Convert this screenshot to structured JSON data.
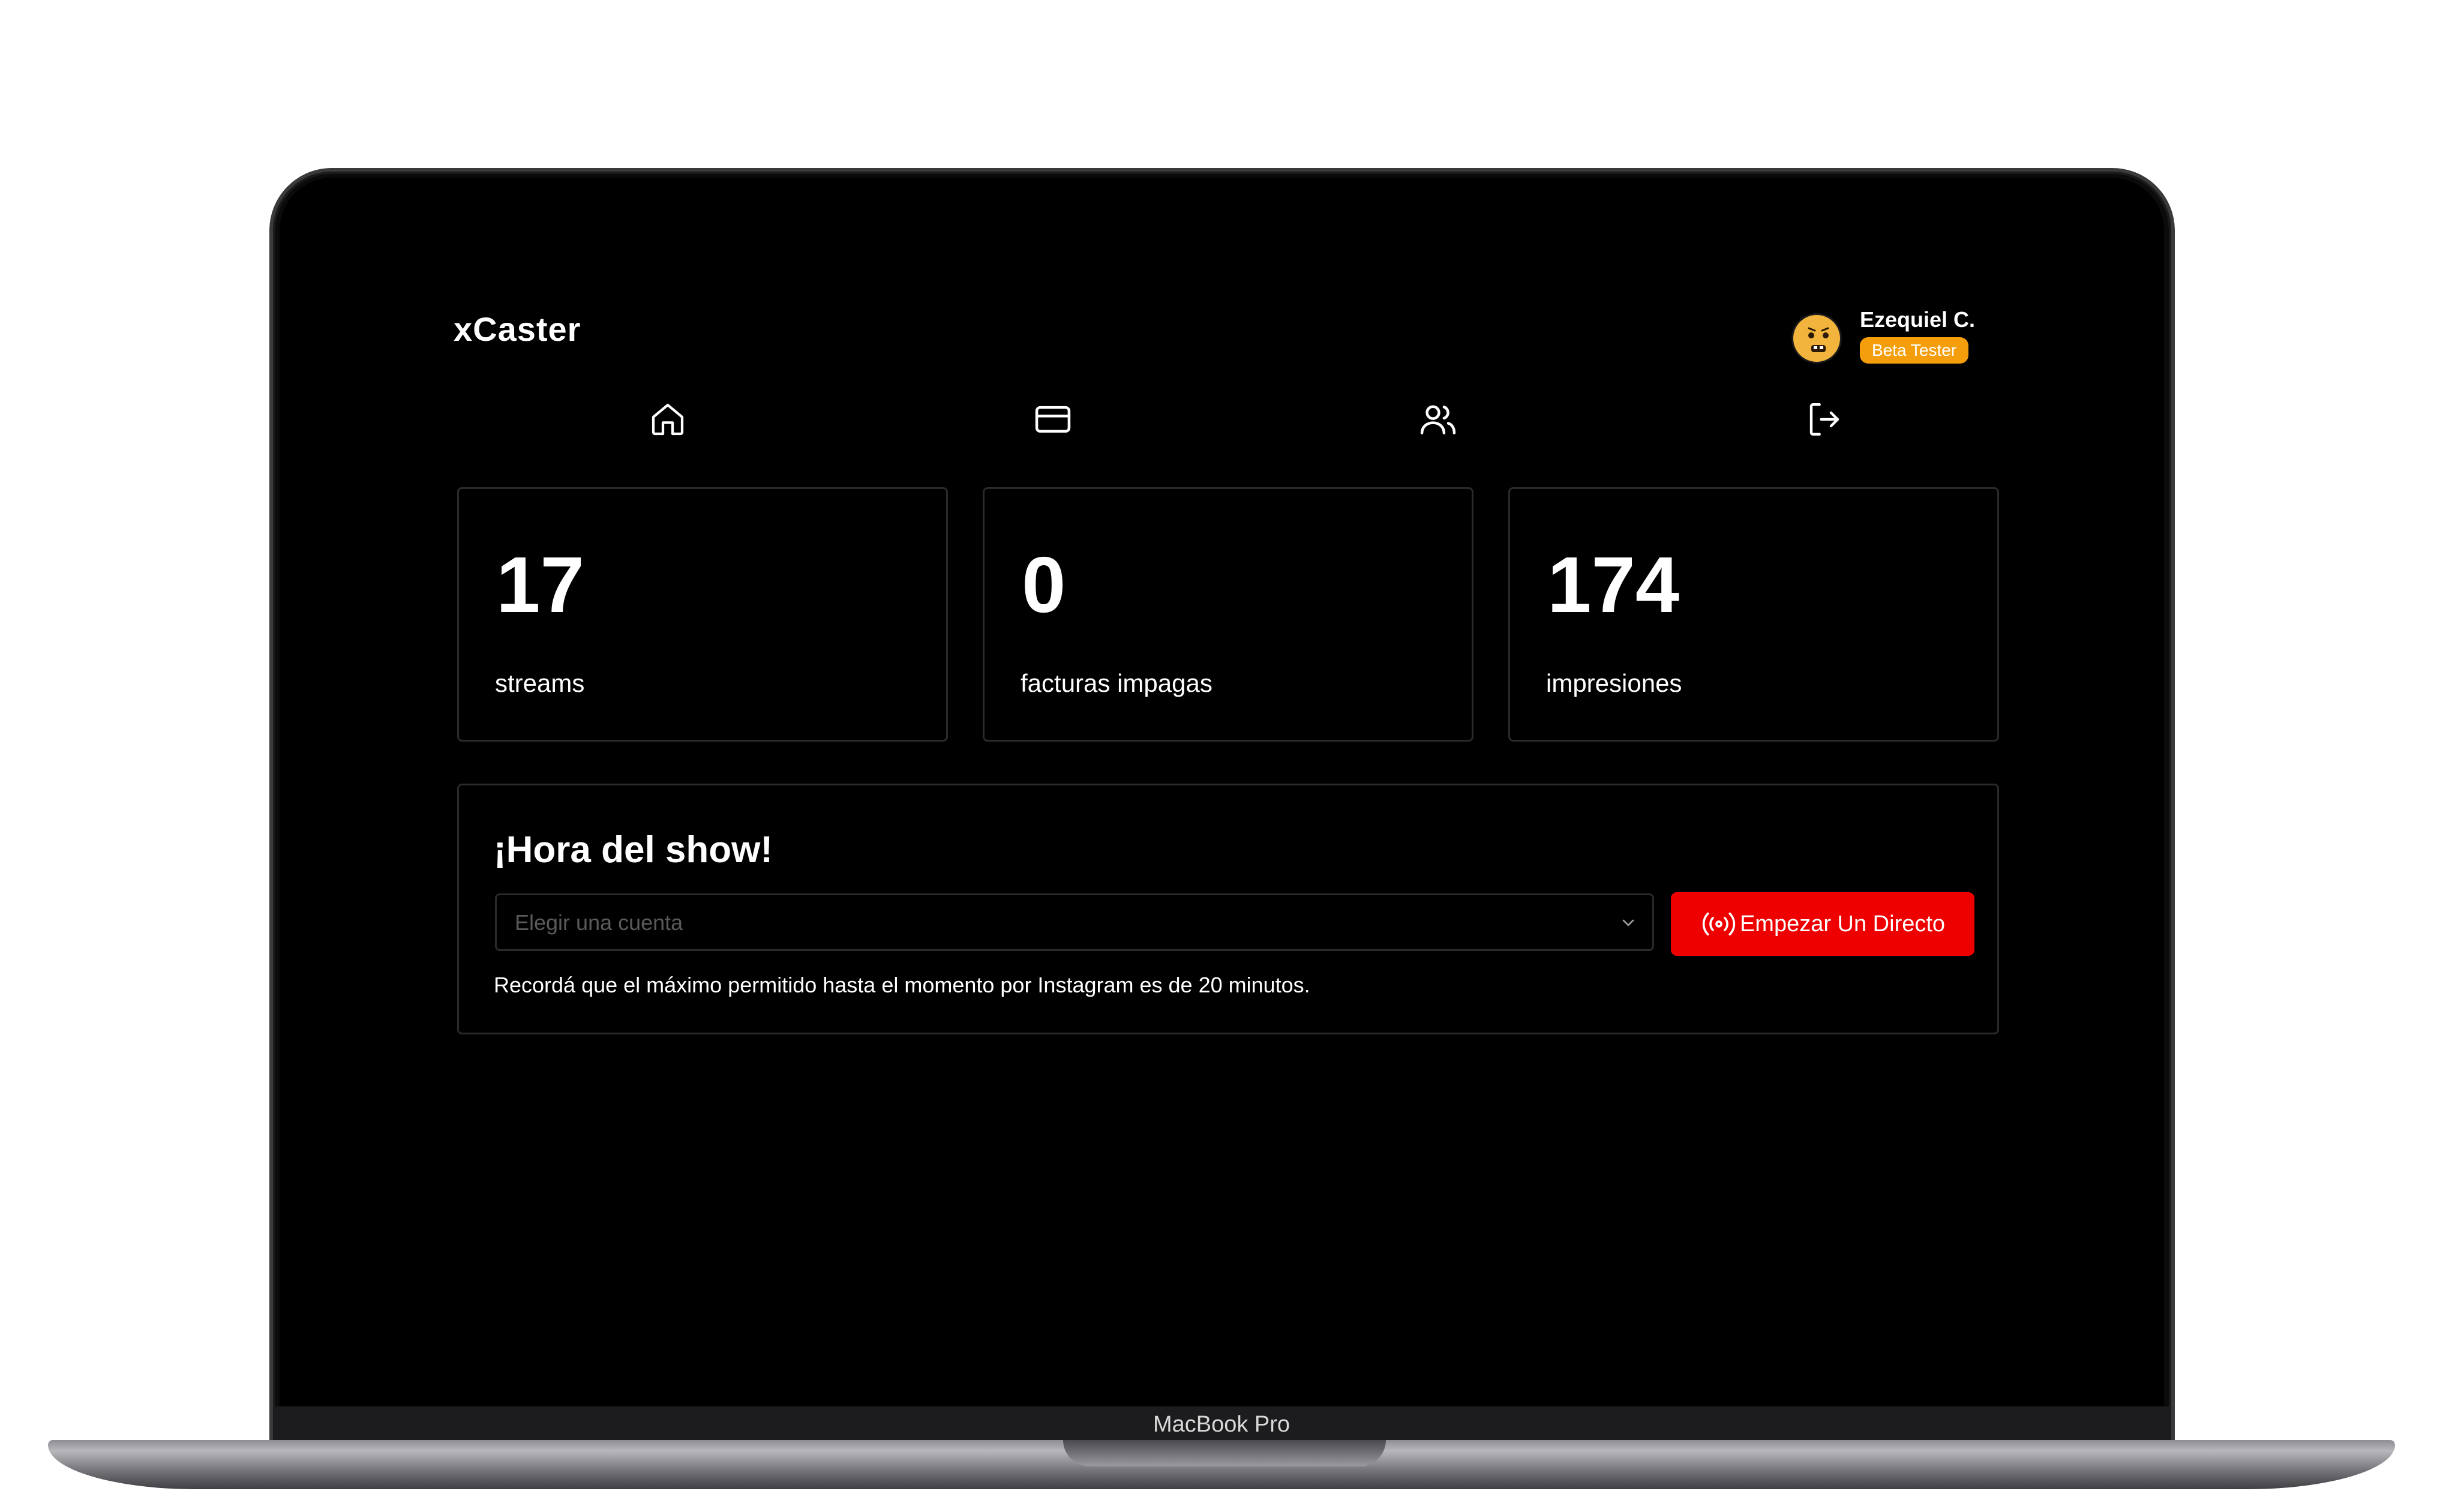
{
  "app": {
    "brand": "xCaster"
  },
  "user": {
    "name": "Ezequiel C.",
    "badge": "Beta Tester"
  },
  "nav": {
    "items": [
      {
        "icon": "home-icon"
      },
      {
        "icon": "credit-card-icon"
      },
      {
        "icon": "users-icon"
      },
      {
        "icon": "logout-icon"
      }
    ]
  },
  "stats": [
    {
      "value": "17",
      "label": "streams"
    },
    {
      "value": "0",
      "label": "facturas impagas"
    },
    {
      "value": "174",
      "label": "impresiones"
    }
  ],
  "show": {
    "title": "¡Hora del show!",
    "select_placeholder": "Elegir una cuenta",
    "button_label": "Empezar Un Directo",
    "button_icon": "broadcast-icon",
    "note": "Recordá que el máximo permitido hasta el momento por Instagram es de 20 minutos."
  },
  "device": {
    "label": "MacBook Pro"
  },
  "colors": {
    "background": "#000000",
    "accent": "#ee0000",
    "badge": "#f59e0b"
  }
}
